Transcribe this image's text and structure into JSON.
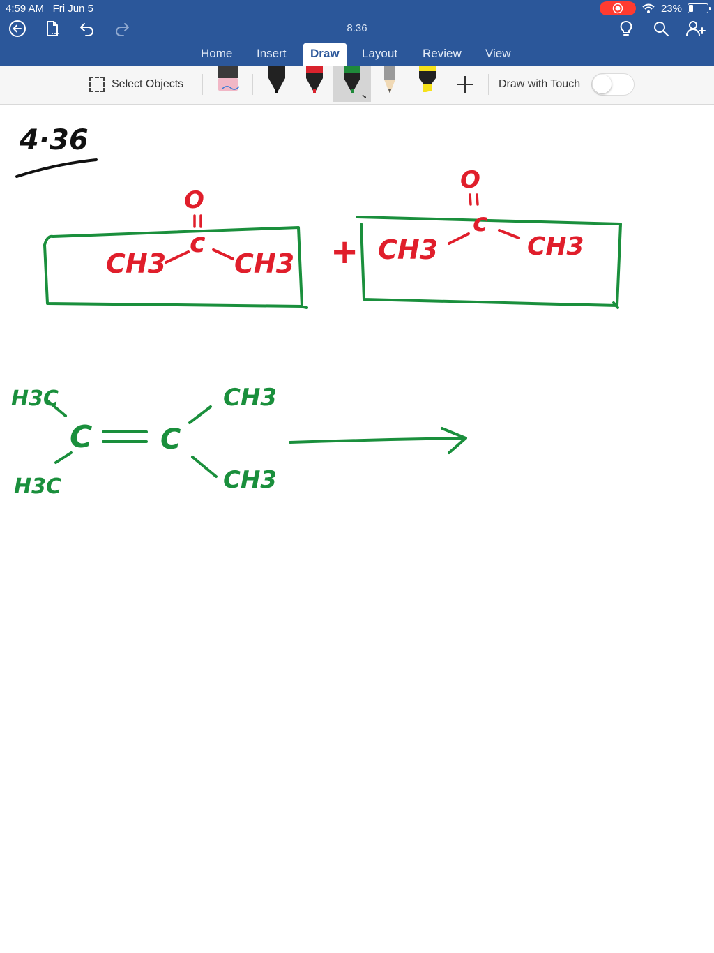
{
  "status_bar": {
    "time": "4:59 AM",
    "date": "Fri Jun 5",
    "battery": "23%",
    "battery_level": 0.23
  },
  "header": {
    "doc_title": "8.36"
  },
  "tabs": [
    {
      "label": "Home",
      "active": false
    },
    {
      "label": "Insert",
      "active": false
    },
    {
      "label": "Draw",
      "active": true
    },
    {
      "label": "Layout",
      "active": false
    },
    {
      "label": "Review",
      "active": false
    },
    {
      "label": "View",
      "active": false
    }
  ],
  "toolbar": {
    "select_objects_label": "Select Objects",
    "draw_with_touch_label": "Draw with Touch",
    "draw_with_touch_on": false,
    "pens": [
      {
        "name": "eraser",
        "color": "#e0a0b0"
      },
      {
        "name": "black-pen",
        "color": "#222222"
      },
      {
        "name": "red-pen",
        "color": "#d9232d"
      },
      {
        "name": "green-pen",
        "color": "#1f8a3a",
        "selected": true
      },
      {
        "name": "pencil",
        "color": "#9a9a9a"
      },
      {
        "name": "highlighter",
        "color": "#f5e11a"
      }
    ]
  },
  "colors": {
    "brand": "#2b579a",
    "ink_black": "#111111",
    "ink_red": "#e01e2b",
    "ink_green": "#1a8f3c"
  },
  "ink": {
    "problem_number": "4·36",
    "acetone_left": {
      "oxygen": "O",
      "carbon": "c",
      "group_left": "CH3",
      "group_right": "CH3"
    },
    "plus_sign": "+",
    "acetone_right": {
      "oxygen": "O",
      "carbon": "c",
      "group_left": "CH3",
      "group_right": "CH3"
    },
    "alkene": {
      "group_top_left": "H3C",
      "group_bottom_left": "H3C",
      "carbon_left": "C",
      "carbon_right": "C",
      "group_top_right": "CH3",
      "group_bottom_right": "CH3"
    }
  }
}
